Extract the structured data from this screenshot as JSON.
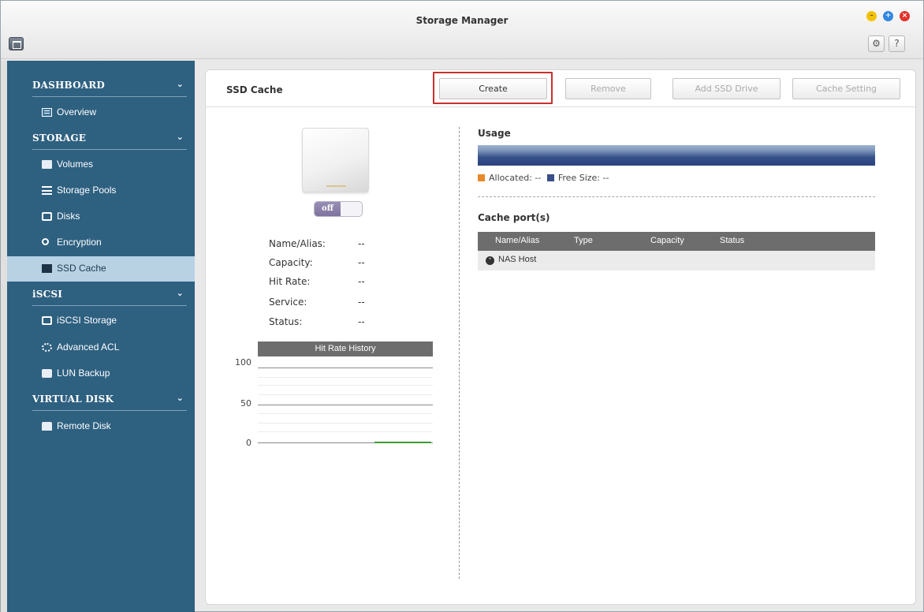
{
  "window": {
    "title": "Storage Manager",
    "controls": [
      "minimize",
      "maximize",
      "close"
    ],
    "toolbar_buttons": [
      {
        "name": "settings",
        "glyph": "⚙"
      },
      {
        "name": "help",
        "glyph": "?"
      }
    ]
  },
  "sidebar": {
    "sections": [
      {
        "label": "DASHBOARD",
        "items": [
          {
            "label": "Overview",
            "icon": "overview-icon"
          }
        ]
      },
      {
        "label": "STORAGE",
        "items": [
          {
            "label": "Volumes",
            "icon": "volume-icon"
          },
          {
            "label": "Storage Pools",
            "icon": "storage-pool-icon"
          },
          {
            "label": "Disks",
            "icon": "disk-icon"
          },
          {
            "label": "Encryption",
            "icon": "key-icon"
          },
          {
            "label": "SSD Cache",
            "icon": "ssd-icon",
            "active": true
          }
        ]
      },
      {
        "label": "iSCSI",
        "items": [
          {
            "label": "iSCSI Storage",
            "icon": "iscsi-icon"
          },
          {
            "label": "Advanced ACL",
            "icon": "acl-icon"
          },
          {
            "label": "LUN Backup",
            "icon": "lun-backup-icon"
          }
        ]
      },
      {
        "label": "VIRTUAL DISK",
        "items": [
          {
            "label": "Remote Disk",
            "icon": "remote-disk-icon"
          }
        ]
      }
    ],
    "chevron": "⌄"
  },
  "panel": {
    "title": "SSD Cache",
    "buttons": {
      "create": "Create",
      "remove": "Remove",
      "add_ssd_drive": "Add SSD Drive",
      "cache_setting": "Cache Setting"
    },
    "toggle_label": "off",
    "info": [
      {
        "label": "Name/Alias:",
        "value": "--"
      },
      {
        "label": "Capacity:",
        "value": "--"
      },
      {
        "label": "Hit Rate:",
        "value": "--"
      },
      {
        "label": "Service:",
        "value": "--"
      },
      {
        "label": "Status:",
        "value": "--"
      }
    ],
    "hit_rate_history": {
      "title": "Hit Rate History",
      "ticks": [
        "100",
        "50",
        "0"
      ]
    },
    "usage": {
      "title": "Usage",
      "allocated_label": "Allocated: --",
      "free_label": "Free Size: --",
      "colors": {
        "allocated": "#e8892a",
        "free": "#3a4f8a"
      }
    },
    "cache_ports": {
      "title": "Cache port(s)",
      "columns": [
        "Name/Alias",
        "Type",
        "Capacity",
        "Status"
      ],
      "rows": [
        {
          "name": "NAS Host",
          "type": "",
          "capacity": "",
          "status": "",
          "expander": "⌃"
        }
      ]
    }
  },
  "colors": {
    "sidebar_bg": "#2e6080",
    "sidebar_active": "#b8d2e4",
    "highlight": "#c8302e"
  }
}
